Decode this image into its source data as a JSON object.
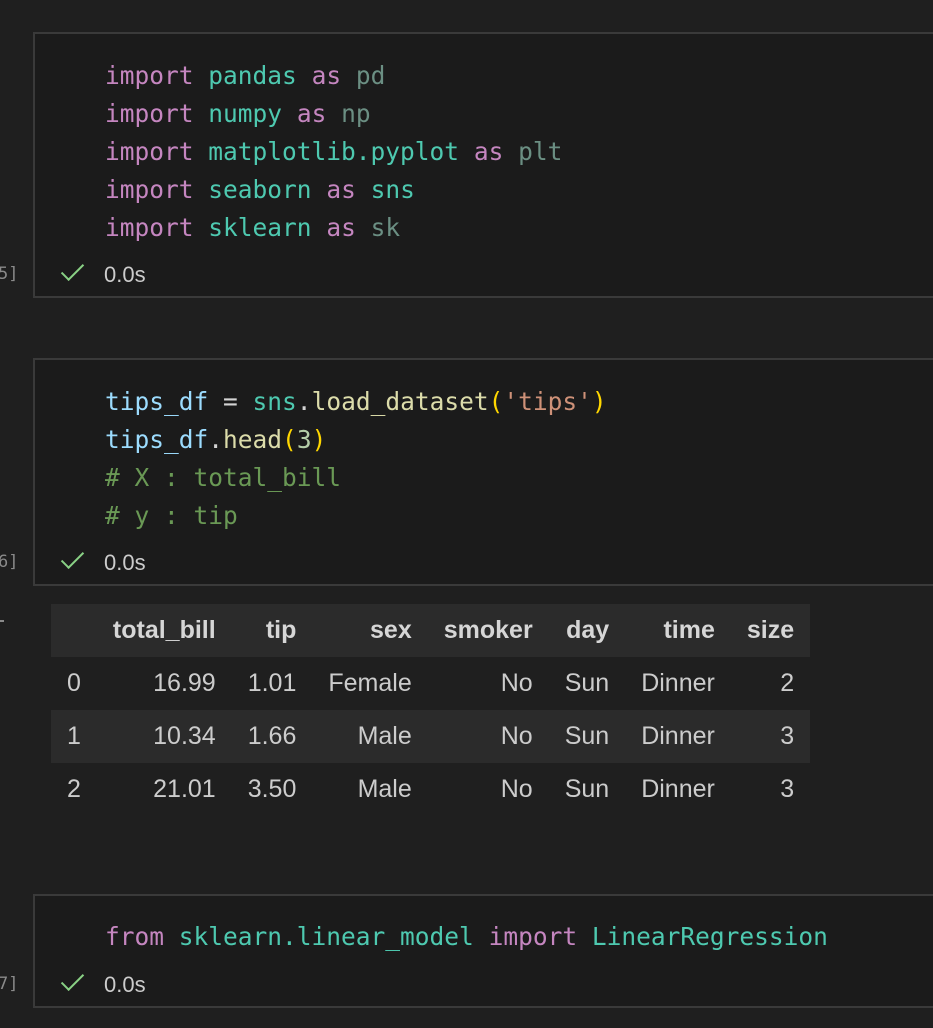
{
  "cells": [
    {
      "exec_count": "5]",
      "status": "0.0s",
      "code": [
        [
          {
            "t": "import",
            "c": "kw"
          },
          {
            "t": " ",
            "c": "plain"
          },
          {
            "t": "pandas",
            "c": "mod"
          },
          {
            "t": " ",
            "c": "plain"
          },
          {
            "t": "as",
            "c": "kw"
          },
          {
            "t": " ",
            "c": "plain"
          },
          {
            "t": "pd",
            "c": "alias"
          }
        ],
        [
          {
            "t": "import",
            "c": "kw"
          },
          {
            "t": " ",
            "c": "plain"
          },
          {
            "t": "numpy",
            "c": "mod"
          },
          {
            "t": " ",
            "c": "plain"
          },
          {
            "t": "as",
            "c": "kw"
          },
          {
            "t": " ",
            "c": "plain"
          },
          {
            "t": "np",
            "c": "alias"
          }
        ],
        [
          {
            "t": "import",
            "c": "kw"
          },
          {
            "t": " ",
            "c": "plain"
          },
          {
            "t": "matplotlib.pyplot",
            "c": "mod"
          },
          {
            "t": " ",
            "c": "plain"
          },
          {
            "t": "as",
            "c": "kw"
          },
          {
            "t": " ",
            "c": "plain"
          },
          {
            "t": "plt",
            "c": "alias"
          }
        ],
        [
          {
            "t": "import",
            "c": "kw"
          },
          {
            "t": " ",
            "c": "plain"
          },
          {
            "t": "seaborn",
            "c": "mod"
          },
          {
            "t": " ",
            "c": "plain"
          },
          {
            "t": "as",
            "c": "kw"
          },
          {
            "t": " ",
            "c": "plain"
          },
          {
            "t": "sns",
            "c": "mod"
          }
        ],
        [
          {
            "t": "import",
            "c": "kw"
          },
          {
            "t": " ",
            "c": "plain"
          },
          {
            "t": "sklearn",
            "c": "mod"
          },
          {
            "t": " ",
            "c": "plain"
          },
          {
            "t": "as",
            "c": "kw"
          },
          {
            "t": " ",
            "c": "plain"
          },
          {
            "t": "sk",
            "c": "alias"
          }
        ]
      ]
    },
    {
      "exec_count": "6]",
      "status": "0.0s",
      "code": [
        [
          {
            "t": "tips_df",
            "c": "var"
          },
          {
            "t": " = ",
            "c": "plain"
          },
          {
            "t": "sns",
            "c": "mod"
          },
          {
            "t": ".",
            "c": "plain"
          },
          {
            "t": "load_dataset",
            "c": "fn"
          },
          {
            "t": "(",
            "c": "brk"
          },
          {
            "t": "'tips'",
            "c": "str"
          },
          {
            "t": ")",
            "c": "brk"
          }
        ],
        [
          {
            "t": "tips_df",
            "c": "var"
          },
          {
            "t": ".",
            "c": "plain"
          },
          {
            "t": "head",
            "c": "fn"
          },
          {
            "t": "(",
            "c": "brk"
          },
          {
            "t": "3",
            "c": "num"
          },
          {
            "t": ")",
            "c": "brk"
          }
        ],
        [
          {
            "t": "# X : total_bill",
            "c": "cmt"
          }
        ],
        [
          {
            "t": "# y : tip",
            "c": "cmt"
          }
        ]
      ]
    },
    {
      "exec_count": "7]",
      "status": "0.0s",
      "code": [
        [
          {
            "t": "from",
            "c": "kw"
          },
          {
            "t": " ",
            "c": "plain"
          },
          {
            "t": "sklearn.linear_model",
            "c": "mod"
          },
          {
            "t": " ",
            "c": "plain"
          },
          {
            "t": "import",
            "c": "kw"
          },
          {
            "t": " ",
            "c": "plain"
          },
          {
            "t": "LinearRegression",
            "c": "mod"
          }
        ]
      ]
    }
  ],
  "dataframe": {
    "columns": [
      "",
      "total_bill",
      "tip",
      "sex",
      "smoker",
      "day",
      "time",
      "size"
    ],
    "rows": [
      [
        "0",
        "16.99",
        "1.01",
        "Female",
        "No",
        "Sun",
        "Dinner",
        "2"
      ],
      [
        "1",
        "10.34",
        "1.66",
        "Male",
        "No",
        "Sun",
        "Dinner",
        "3"
      ],
      [
        "2",
        "21.01",
        "3.50",
        "Male",
        "No",
        "Sun",
        "Dinner",
        "3"
      ]
    ]
  }
}
